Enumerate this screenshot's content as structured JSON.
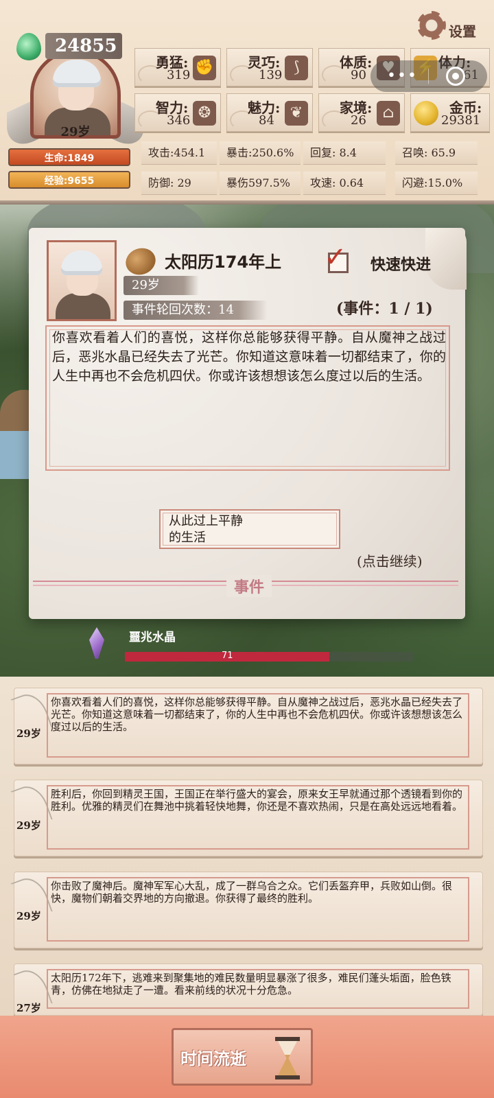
{
  "header": {
    "score": "24855",
    "age": "29岁",
    "hp_label": "生命:1849",
    "xp_label": "经验:9655",
    "settings_label": "设置",
    "attributes": [
      {
        "label": "勇猛:",
        "value": "319",
        "icon": "fist-icon"
      },
      {
        "label": "灵巧:",
        "value": "139",
        "icon": "cloak-icon"
      },
      {
        "label": "体质:",
        "value": "90",
        "icon": "heart-icon"
      },
      {
        "label": "体力:",
        "value": "61",
        "icon": "lightning-icon"
      },
      {
        "label": "智力:",
        "value": "346",
        "icon": "brain-icon"
      },
      {
        "label": "魅力:",
        "value": "84",
        "icon": "flower-icon"
      },
      {
        "label": "家境:",
        "value": "26",
        "icon": "house-icon"
      },
      {
        "label": "金币:",
        "value": "29381",
        "icon": "coin-icon"
      }
    ],
    "combat_stats": [
      [
        "攻击:454.1",
        "暴击:250.6%",
        "回复:    8.4",
        "召唤:   65.9"
      ],
      [
        "防御:    29",
        "暴伤597.5%",
        "攻速:   0.64",
        "闪避:15.0%"
      ]
    ]
  },
  "event_card": {
    "date": "太阳历174年上",
    "fast_forward_label": "快速快进",
    "age": "29岁",
    "rounds": "事件轮回次数：14",
    "event_count": "(事件：1 / 1)",
    "text": "你喜欢看着人们的喜悦，这样你总能够获得平静。自从魔神之战过后，恶兆水晶已经失去了光芒。你知道这意味着一切都结束了，你的人生中再也不会危机四伏。你或许该想想该怎么度过以后的生活。",
    "choice": "从此过上平静的生活",
    "continue_label": "(点击继续)",
    "section_label": "事件"
  },
  "crystal": {
    "name": "噩兆水晶",
    "value": "71",
    "fill_fraction": 0.71,
    "color": "#c0283d"
  },
  "log": [
    {
      "age": "29岁",
      "text": "你喜欢看着人们的喜悦，这样你总能够获得平静。自从魔神之战过后，恶兆水晶已经失去了光芒。你知道这意味着一切都结束了，你的人生中再也不会危机四伏。你或许该想想该怎么度过以后的生活。"
    },
    {
      "age": "29岁",
      "text": "胜利后，你回到精灵王国，王国正在举行盛大的宴会，原来女王早就通过那个透镜看到你的胜利。优雅的精灵们在舞池中挑着轻快地舞，你还是不喜欢热闹，只是在高处远远地看着。"
    },
    {
      "age": "29岁",
      "text": "你击败了魔神后。魔神军军心大乱，成了一群乌合之众。它们丢盔弃甲，兵败如山倒。很快，魔物们朝着交界地的方向撤退。你获得了最终的胜利。"
    },
    {
      "age": "27岁",
      "text": "太阳历172年下，逃难来到聚集地的难民数量明显暴涨了很多，难民们蓬头垢面，脸色铁青，仿佛在地狱走了一遭。看来前线的状况十分危急。"
    }
  ],
  "footer": {
    "time_button_label": "时间流逝"
  },
  "colors": {
    "accent": "#b36c5a",
    "hp": "#d55a2e",
    "xp": "#e29e3f",
    "check": "#c0392b"
  }
}
